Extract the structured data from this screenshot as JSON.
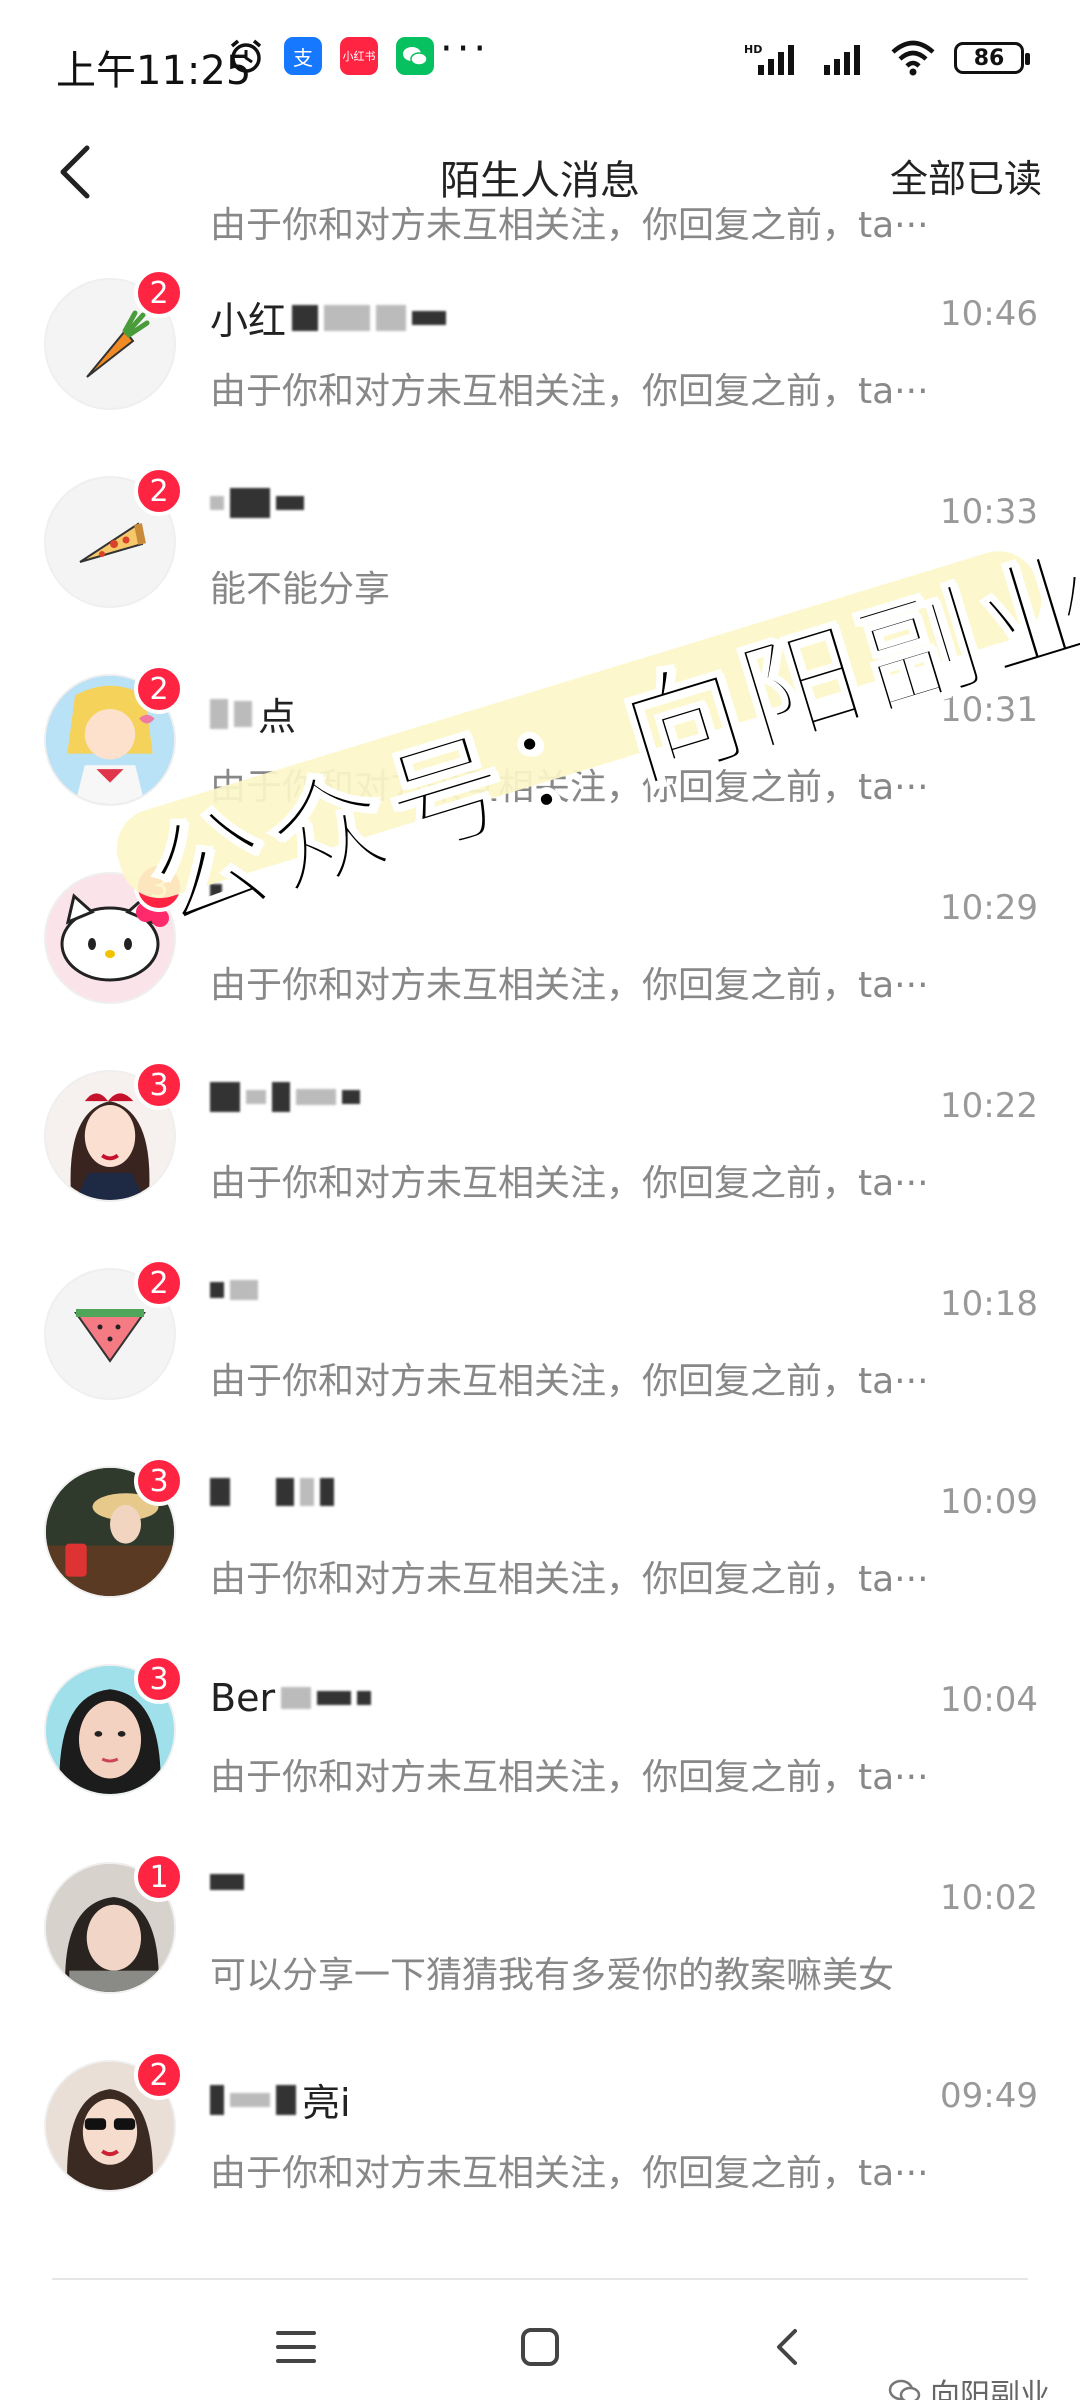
{
  "status_bar": {
    "time": "上午11:25",
    "network": "HD",
    "battery": "86",
    "more": "···",
    "app_icon_badge": "小红书"
  },
  "header": {
    "title": "陌生人消息",
    "read_all": "全部已读"
  },
  "top_partial_preview": "由于你和对方未互相关注，你回复之前，ta···",
  "messages": [
    {
      "name_visible": "小红",
      "time": "10:46",
      "preview": "由于你和对方未互相关注，你回复之前，ta···",
      "badge": "2",
      "avatar": "carrot"
    },
    {
      "name_visible": "",
      "time": "10:33",
      "preview": "能不能分享",
      "badge": "2",
      "avatar": "pizza"
    },
    {
      "name_visible": "点",
      "time": "10:31",
      "preview": "由于你和对方未互相关注，你回复之前，ta···",
      "badge": "2",
      "avatar": "anime"
    },
    {
      "name_visible": "",
      "time": "10:29",
      "preview": "由于你和对方未互相关注，你回复之前，ta···",
      "badge": "3",
      "avatar": "kitty"
    },
    {
      "name_visible": "",
      "time": "10:22",
      "preview": "由于你和对方未互相关注，你回复之前，ta···",
      "badge": "3",
      "avatar": "girl-drawing"
    },
    {
      "name_visible": "",
      "time": "10:18",
      "preview": "由于你和对方未互相关注，你回复之前，ta···",
      "badge": "2",
      "avatar": "watermelon"
    },
    {
      "name_visible": "",
      "time": "10:09",
      "preview": "由于你和对方未互相关注，你回复之前，ta···",
      "badge": "3",
      "avatar": "photo-hat"
    },
    {
      "name_visible": "Ber",
      "time": "10:04",
      "preview": "由于你和对方未互相关注，你回复之前，ta···",
      "badge": "3",
      "avatar": "photo-face"
    },
    {
      "name_visible": "",
      "time": "10:02",
      "preview": "可以分享一下猜猜我有多爱你的教案嘛美女",
      "badge": "1",
      "avatar": "photo-girl"
    },
    {
      "name_visible": "亮i",
      "time": "09:49",
      "preview": "由于你和对方未互相关注，你回复之前，ta···",
      "badge": "2",
      "avatar": "photo-glasses"
    }
  ],
  "watermark": "公众号：向阳副业",
  "corner_watermark": "向阳副业",
  "colors": {
    "badge": "#ff2442",
    "stripe": "#fdf6c9",
    "time": "#999999",
    "preview": "#888888"
  }
}
